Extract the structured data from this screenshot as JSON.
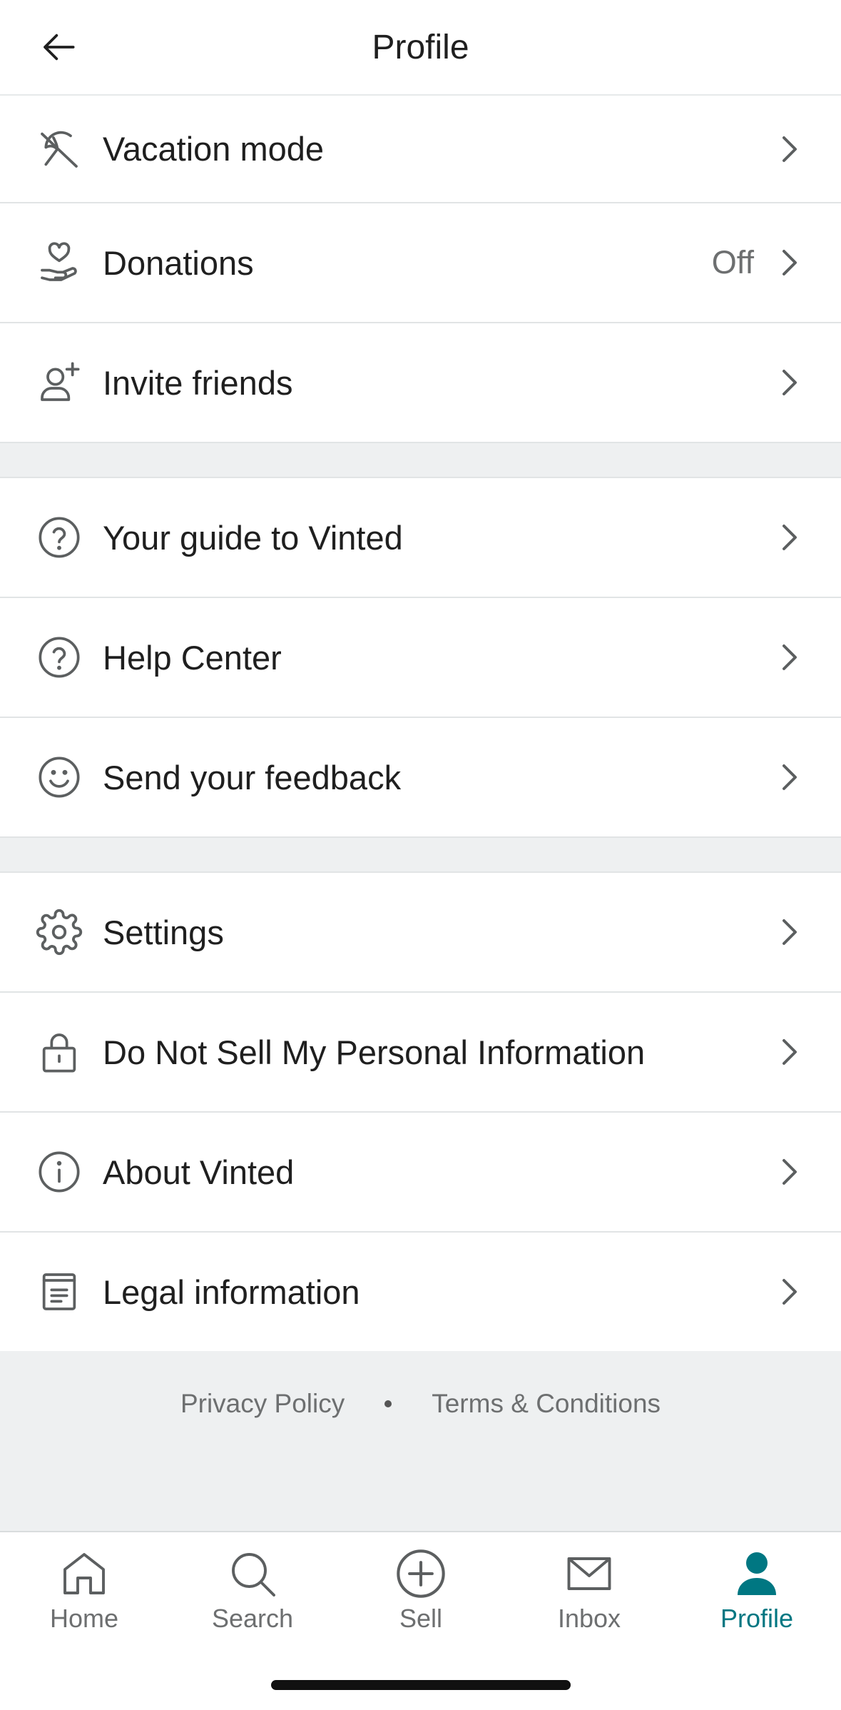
{
  "header": {
    "title": "Profile"
  },
  "menu": {
    "vacation": {
      "label": "Vacation mode",
      "icon": "umbrella-off-icon"
    },
    "donations": {
      "label": "Donations",
      "value": "Off",
      "icon": "heart-hand-icon"
    },
    "invite": {
      "label": "Invite friends",
      "icon": "user-plus-icon"
    },
    "guide": {
      "label": "Your guide to Vinted",
      "icon": "question-circle-icon"
    },
    "help": {
      "label": "Help Center",
      "icon": "question-circle-icon"
    },
    "feedback": {
      "label": "Send your feedback",
      "icon": "smiley-icon"
    },
    "settings": {
      "label": "Settings",
      "icon": "gear-icon"
    },
    "dnsmpi": {
      "label": "Do Not Sell My Personal Information",
      "icon": "lock-icon"
    },
    "about": {
      "label": "About Vinted",
      "icon": "info-circle-icon"
    },
    "legal": {
      "label": "Legal information",
      "icon": "document-icon"
    }
  },
  "footer": {
    "privacy": "Privacy Policy",
    "terms": "Terms & Conditions"
  },
  "tabs": {
    "home": "Home",
    "search": "Search",
    "sell": "Sell",
    "inbox": "Inbox",
    "profile": "Profile"
  },
  "colors": {
    "accent": "#007782",
    "icon": "#5c5f60",
    "text": "#1f1f1f",
    "muted": "#6d6f70",
    "section_gap": "#eef0f1"
  }
}
